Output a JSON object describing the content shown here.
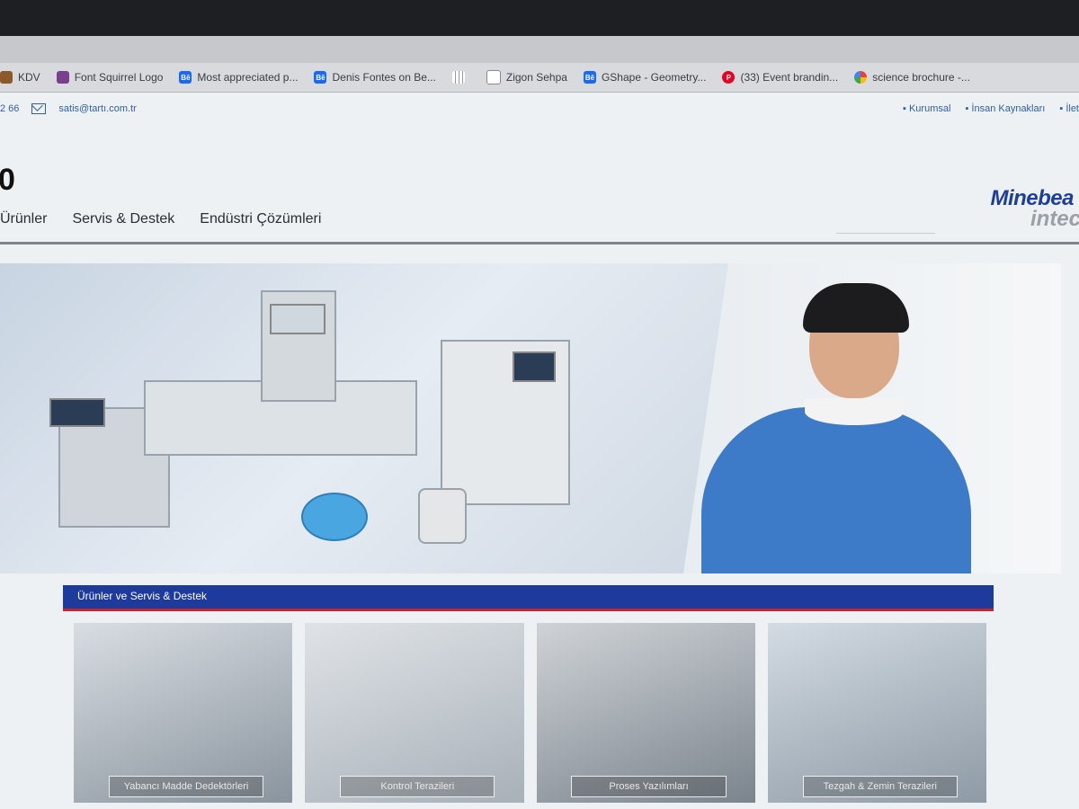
{
  "browser": {
    "bookmarks": [
      {
        "label": "KDV",
        "icon": "bookmark-icon"
      },
      {
        "label": "Font Squirrel Logo",
        "icon": "squirrel-icon"
      },
      {
        "label": "Most appreciated p...",
        "icon": "behance-icon"
      },
      {
        "label": "Denis Fontes on Be...",
        "icon": "behance-icon"
      },
      {
        "label": "",
        "icon": "grid-icon"
      },
      {
        "label": "Zigon Sehpa",
        "icon": "document-icon"
      },
      {
        "label": "GShape - Geometry...",
        "icon": "behance-icon"
      },
      {
        "label": "(33) Event brandin...",
        "icon": "pinterest-icon"
      },
      {
        "label": "science brochure -...",
        "icon": "google-icon"
      }
    ]
  },
  "utility": {
    "phone": "2 66",
    "email": "satis@tartı.com.tr",
    "links": [
      "Kurumsal",
      "İnsan Kaynakları",
      "İlet"
    ]
  },
  "header": {
    "site_title": "0",
    "logo_top": "Minebea",
    "logo_bottom": "intec"
  },
  "nav": {
    "items": [
      "Ürünler",
      "Servis & Destek",
      "Endüstri Çözümleri"
    ]
  },
  "section": {
    "title": "Ürünler ve Servis & Destek"
  },
  "cards": [
    {
      "label": "Yabancı Madde Dedektörleri"
    },
    {
      "label": "Kontrol Terazileri"
    },
    {
      "label": "Proses Yazılımları"
    },
    {
      "label": "Tezgah & Zemin Terazileri"
    }
  ],
  "colors": {
    "brand_blue": "#1d3a9c",
    "accent_red": "#c3272b",
    "link_blue": "#2e5fa7"
  }
}
